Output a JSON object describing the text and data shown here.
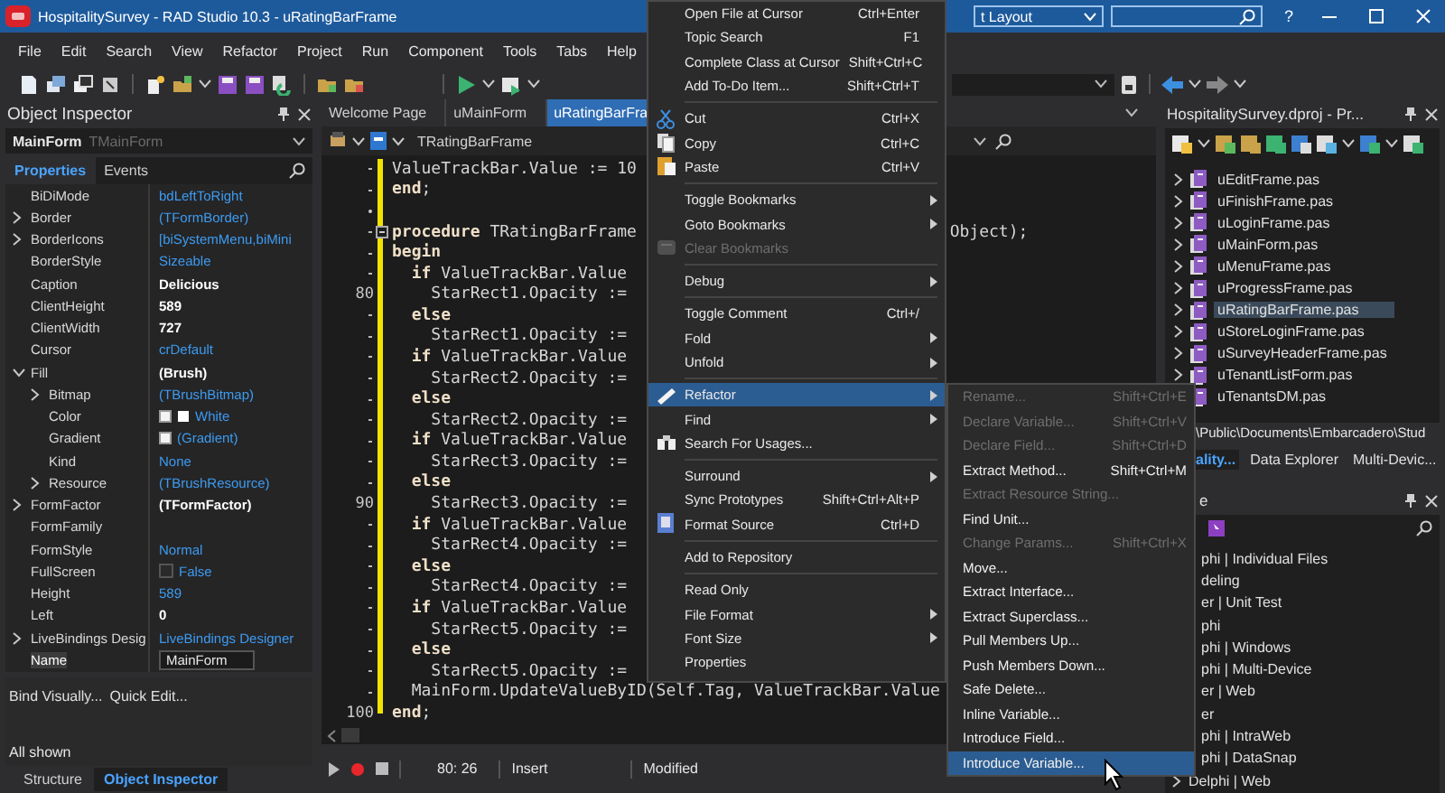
{
  "window": {
    "title": "HospitalitySurvey - RAD Studio 10.3 - uRatingBarFrame",
    "layout": "t Layout",
    "help": "?"
  },
  "menu": [
    "File",
    "Edit",
    "Search",
    "View",
    "Refactor",
    "Project",
    "Run",
    "Component",
    "Tools",
    "Tabs",
    "Help"
  ],
  "object_inspector": {
    "title": "Object Inspector",
    "component": "MainForm",
    "component_type": "TMainForm",
    "tabs": [
      {
        "label": "Properties",
        "selected": true
      },
      {
        "label": "Events",
        "selected": false
      }
    ],
    "properties": [
      {
        "name": "BiDiMode",
        "value": "bdLeftToRight",
        "modified": false,
        "selected": false
      },
      {
        "name": "Border",
        "value": "(TFormBorder)",
        "modified": false,
        "selected": false,
        "expanded": false
      },
      {
        "name": "BorderIcons",
        "value": "[biSystemMenu,biMini",
        "modified": false,
        "selected": false,
        "expanded": false
      },
      {
        "name": "BorderStyle",
        "value": "Sizeable",
        "modified": false,
        "selected": false
      },
      {
        "name": "Caption",
        "value": "Delicious",
        "modified": true,
        "selected": false
      },
      {
        "name": "ClientHeight",
        "value": "589",
        "modified": true,
        "selected": false
      },
      {
        "name": "ClientWidth",
        "value": "727",
        "modified": true,
        "selected": false
      },
      {
        "name": "Cursor",
        "value": "crDefault",
        "modified": false,
        "selected": false
      },
      {
        "name": "Fill",
        "value": "(Brush)",
        "modified": true,
        "selected": false,
        "expanded": true,
        "children": [
          {
            "name": "Bitmap",
            "value": "(TBrushBitmap)",
            "modified": false,
            "selected": false,
            "expanded": false
          },
          {
            "name": "Color",
            "value": "White",
            "modified": false,
            "selected": false,
            "kind": "color"
          },
          {
            "name": "Gradient",
            "value": "(Gradient)",
            "modified": false,
            "selected": false,
            "kind": "gradient"
          },
          {
            "name": "Kind",
            "value": "None",
            "modified": false,
            "selected": false
          },
          {
            "name": "Resource",
            "value": "(TBrushResource)",
            "modified": false,
            "selected": false,
            "expanded": false
          }
        ]
      },
      {
        "name": "FormFactor",
        "value": "(TFormFactor)",
        "modified": true,
        "selected": false,
        "expanded": false
      },
      {
        "name": "FormFamily",
        "selected": false
      },
      {
        "name": "FormStyle",
        "value": "Normal",
        "modified": false,
        "selected": false
      },
      {
        "name": "FullScreen",
        "value": "False",
        "modified": false,
        "selected": false,
        "kind": "checkbox",
        "checked": false
      },
      {
        "name": "Height",
        "value": "589",
        "modified": false,
        "selected": false
      },
      {
        "name": "Left",
        "value": "0",
        "modified": true,
        "selected": false
      },
      {
        "name": "LiveBindings Desig",
        "value": "LiveBindings Designer",
        "modified": false,
        "selected": false,
        "expanded": false
      },
      {
        "name": "Name",
        "value": "MainForm",
        "modified": false,
        "selected": true
      }
    ],
    "actions": [
      "Bind Visually...",
      "Quick Edit..."
    ],
    "status": "All shown",
    "bottom_tabs": [
      {
        "label": "Structure",
        "selected": false
      },
      {
        "label": "Object Inspector",
        "selected": true
      }
    ]
  },
  "editor": {
    "tabs": [
      {
        "label": "Welcome Page",
        "selected": false
      },
      {
        "label": "uMainForm",
        "selected": false
      },
      {
        "label": "uRatingBarFra",
        "selected": true
      }
    ],
    "class_combo": "TRatingBarFrame",
    "lines": [
      {
        "text": "ValueTrackBar.Value := 10"
      },
      {
        "text": "**end**;"
      },
      {
        "kind": "blank"
      },
      {
        "text": "**procedure** TRatingBarFrame",
        "tail": "Object);",
        "expanded": true
      },
      {
        "text": "**begin**"
      },
      {
        "text": "  **if** ValueTrackBar.Value"
      },
      {
        "text": "    StarRect1.Opacity :=",
        "number": "80"
      },
      {
        "text": "  **else**"
      },
      {
        "text": "    StarRect1.Opacity :="
      },
      {
        "text": "  **if** ValueTrackBar.Value"
      },
      {
        "text": "    StarRect2.Opacity :="
      },
      {
        "text": "  **else**"
      },
      {
        "text": "    StarRect2.Opacity :="
      },
      {
        "text": "  **if** ValueTrackBar.Value"
      },
      {
        "text": "    StarRect3.Opacity :="
      },
      {
        "text": "  **else**"
      },
      {
        "text": "    StarRect3.Opacity :=",
        "number": "90"
      },
      {
        "text": "  **if** ValueTrackBar.Value"
      },
      {
        "text": "    StarRect4.Opacity :="
      },
      {
        "text": "  **else**"
      },
      {
        "text": "    StarRect4.Opacity :="
      },
      {
        "text": "  **if** ValueTrackBar.Value"
      },
      {
        "text": "    StarRect5.Opacity :="
      },
      {
        "text": "  **else**"
      },
      {
        "text": "    StarRect5.Opacity :="
      },
      {
        "text": "  MainForm.UpdateValueByID(Self.Tag, ValueTrackBar.Value"
      },
      {
        "text": "**end**;",
        "number": "100"
      }
    ],
    "status": {
      "position": "80: 26",
      "mode": "Insert",
      "state": "Modified"
    }
  },
  "context_menu": {
    "items": [
      {
        "kind": "item",
        "label": "Open File at Cursor",
        "shortcut": "Ctrl+Enter",
        "submenu": false,
        "disabled": false,
        "selected": false
      },
      {
        "kind": "item",
        "label": "Topic Search",
        "shortcut": "F1",
        "submenu": false,
        "disabled": false,
        "selected": false
      },
      {
        "kind": "item",
        "label": "Complete Class at Cursor",
        "shortcut": "Shift+Ctrl+C",
        "submenu": false,
        "disabled": false,
        "selected": false
      },
      {
        "kind": "item",
        "label": "Add To-Do Item...",
        "shortcut": "Shift+Ctrl+T",
        "submenu": false,
        "disabled": false,
        "selected": false
      },
      {
        "kind": "separator"
      },
      {
        "kind": "item",
        "label": "Cut",
        "shortcut": "Ctrl+X",
        "submenu": false,
        "disabled": false,
        "selected": false,
        "icon": true
      },
      {
        "kind": "item",
        "label": "Copy",
        "shortcut": "Ctrl+C",
        "submenu": false,
        "disabled": false,
        "selected": false,
        "icon": true
      },
      {
        "kind": "item",
        "label": "Paste",
        "shortcut": "Ctrl+V",
        "submenu": false,
        "disabled": false,
        "selected": false,
        "icon": true
      },
      {
        "kind": "separator"
      },
      {
        "kind": "item",
        "label": "Toggle Bookmarks",
        "submenu": true,
        "disabled": false,
        "selected": false
      },
      {
        "kind": "item",
        "label": "Goto Bookmarks",
        "submenu": true,
        "disabled": false,
        "selected": false
      },
      {
        "kind": "item",
        "label": "Clear Bookmarks",
        "submenu": false,
        "disabled": true,
        "selected": false,
        "icon": true
      },
      {
        "kind": "separator"
      },
      {
        "kind": "item",
        "label": "Debug",
        "submenu": true,
        "disabled": false,
        "selected": false
      },
      {
        "kind": "separator"
      },
      {
        "kind": "item",
        "label": "Toggle Comment",
        "shortcut": "Ctrl+/",
        "submenu": false,
        "disabled": false,
        "selected": false
      },
      {
        "kind": "item",
        "label": "Fold",
        "submenu": true,
        "disabled": false,
        "selected": false
      },
      {
        "kind": "item",
        "label": "Unfold",
        "submenu": true,
        "disabled": false,
        "selected": false
      },
      {
        "kind": "separator"
      },
      {
        "kind": "item",
        "label": "Refactor",
        "submenu": true,
        "disabled": false,
        "selected": true,
        "icon": true
      },
      {
        "kind": "item",
        "label": "Find",
        "submenu": true,
        "disabled": false,
        "selected": false
      },
      {
        "kind": "item",
        "label": "Search For Usages...",
        "submenu": false,
        "disabled": false,
        "selected": false,
        "icon": true
      },
      {
        "kind": "separator"
      },
      {
        "kind": "item",
        "label": "Surround",
        "submenu": true,
        "disabled": false,
        "selected": false
      },
      {
        "kind": "item",
        "label": "Sync Prototypes",
        "shortcut": "Shift+Ctrl+Alt+P",
        "submenu": false,
        "disabled": false,
        "selected": false
      },
      {
        "kind": "item",
        "label": "Format Source",
        "shortcut": "Ctrl+D",
        "submenu": false,
        "disabled": false,
        "selected": false,
        "icon": true
      },
      {
        "kind": "separator"
      },
      {
        "kind": "item",
        "label": "Add to Repository",
        "submenu": false,
        "disabled": false,
        "selected": false
      },
      {
        "kind": "separator"
      },
      {
        "kind": "item",
        "label": "Read Only",
        "submenu": false,
        "disabled": false,
        "selected": false
      },
      {
        "kind": "item",
        "label": "File Format",
        "submenu": true,
        "disabled": false,
        "selected": false
      },
      {
        "kind": "item",
        "label": "Font Size",
        "submenu": true,
        "disabled": false,
        "selected": false
      },
      {
        "kind": "item",
        "label": "Properties",
        "submenu": false,
        "disabled": false,
        "selected": false
      }
    ]
  },
  "refactor_submenu": {
    "items": [
      {
        "label": "Rename...",
        "shortcut": "Shift+Ctrl+E",
        "disabled": true,
        "selected": false
      },
      {
        "label": "Declare Variable...",
        "shortcut": "Shift+Ctrl+V",
        "disabled": true,
        "selected": false
      },
      {
        "label": "Declare Field...",
        "shortcut": "Shift+Ctrl+D",
        "disabled": true,
        "selected": false
      },
      {
        "label": "Extract Method...",
        "shortcut": "Shift+Ctrl+M",
        "disabled": false,
        "selected": false
      },
      {
        "label": "Extract Resource String...",
        "disabled": true,
        "selected": false
      },
      {
        "label": "Find Unit...",
        "disabled": false,
        "selected": false
      },
      {
        "label": "Change Params...",
        "shortcut": "Shift+Ctrl+X",
        "disabled": true,
        "selected": false
      },
      {
        "label": "Move...",
        "disabled": false,
        "selected": false
      },
      {
        "label": "Extract Interface...",
        "disabled": false,
        "selected": false
      },
      {
        "label": "Extract Superclass...",
        "disabled": false,
        "selected": false
      },
      {
        "label": "Pull Members Up...",
        "disabled": false,
        "selected": false
      },
      {
        "label": "Push Members Down...",
        "disabled": false,
        "selected": false
      },
      {
        "label": "Safe Delete...",
        "disabled": false,
        "selected": false
      },
      {
        "label": "Inline Variable...",
        "disabled": false,
        "selected": false
      },
      {
        "label": "Introduce Field...",
        "disabled": false,
        "selected": false
      },
      {
        "label": "Introduce Variable...",
        "disabled": false,
        "selected": true
      }
    ]
  },
  "project_manager": {
    "title": "HospitalitySurvey.dproj - Pr...",
    "files": [
      {
        "name": "uEditFrame.pas",
        "selected": false
      },
      {
        "name": "uFinishFrame.pas",
        "selected": false
      },
      {
        "name": "uLoginFrame.pas",
        "selected": false
      },
      {
        "name": "uMainForm.pas",
        "selected": false
      },
      {
        "name": "uMenuFrame.pas",
        "selected": false
      },
      {
        "name": "uProgressFrame.pas",
        "selected": false
      },
      {
        "name": "uRatingBarFrame.pas",
        "selected": true
      },
      {
        "name": "uStoreLoginFrame.pas",
        "selected": false
      },
      {
        "name": "uSurveyHeaderFrame.pas",
        "selected": false
      },
      {
        "name": "uTenantListForm.pas",
        "selected": false
      },
      {
        "name": "uTenantsDM.pas",
        "selected": false
      }
    ],
    "path": "\\Public\\Documents\\Embarcadero\\Stud",
    "tabs": [
      {
        "label": "ality...",
        "selected": true
      },
      {
        "label": "Data Explorer",
        "selected": false
      },
      {
        "label": "Multi-Devic...",
        "selected": false
      }
    ]
  },
  "palette": {
    "title": "e",
    "items": [
      {
        "label": "phi | Individual Files"
      },
      {
        "label": "deling"
      },
      {
        "label": "er | Unit Test"
      },
      {
        "label": "phi"
      },
      {
        "label": "phi | Windows"
      },
      {
        "label": "phi | Multi-Device"
      },
      {
        "label": "er | Web"
      },
      {
        "label": "er"
      },
      {
        "label": "phi | IntraWeb"
      },
      {
        "label": "phi | DataSnap"
      },
      {
        "label": "Delphi | Web",
        "expanded": false
      }
    ]
  }
}
